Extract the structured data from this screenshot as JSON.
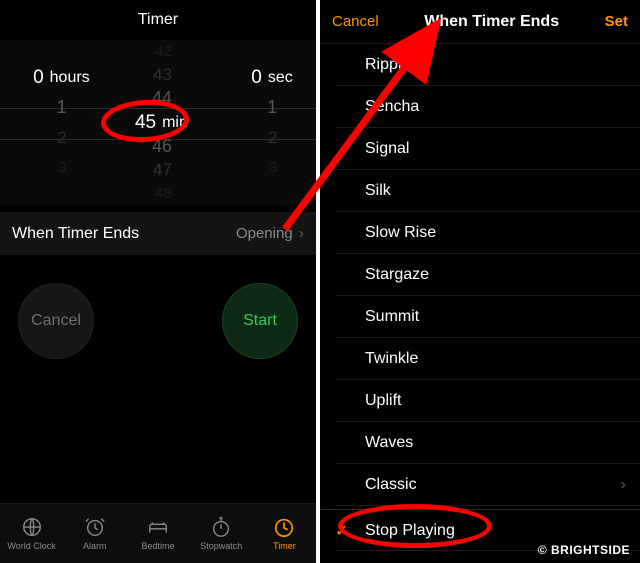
{
  "left": {
    "title": "Timer",
    "picker": {
      "hours": {
        "sel": "0",
        "unit": "hours",
        "below": [
          "1",
          "2",
          "3"
        ]
      },
      "minutes": {
        "sel": "45",
        "unit": "min",
        "above": [
          "42",
          "43",
          "44"
        ],
        "below": [
          "46",
          "47",
          "48"
        ]
      },
      "seconds": {
        "sel": "0",
        "unit": "sec",
        "below": [
          "1",
          "2",
          "3"
        ]
      }
    },
    "wte": {
      "label": "When Timer Ends",
      "value": "Opening"
    },
    "buttons": {
      "cancel": "Cancel",
      "start": "Start"
    },
    "tabs": [
      "World Clock",
      "Alarm",
      "Bedtime",
      "Stopwatch",
      "Timer"
    ]
  },
  "right": {
    "cancel": "Cancel",
    "title": "When Timer Ends",
    "set": "Set",
    "sounds": [
      "Ripples",
      "Sencha",
      "Signal",
      "Silk",
      "Slow Rise",
      "Stargaze",
      "Summit",
      "Twinkle",
      "Uplift",
      "Waves"
    ],
    "classic": "Classic",
    "stop": "Stop Playing"
  },
  "watermark": "© BRIGHTSIDE"
}
